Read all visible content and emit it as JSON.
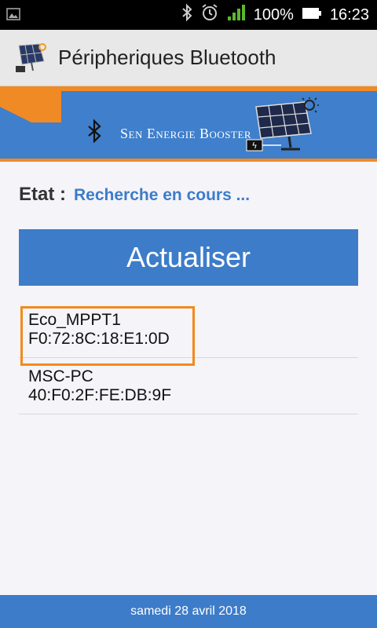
{
  "status_bar": {
    "battery": "100%",
    "time": "16:23",
    "icons": [
      "image-icon",
      "bluetooth-icon",
      "alarm-icon",
      "signal-icon",
      "battery-icon"
    ]
  },
  "action_bar": {
    "title": "Péripheriques Bluetooth",
    "icon": "solar-panel-icon"
  },
  "banner": {
    "brand": "Sen Energie Booster",
    "icons": [
      "bluetooth-icon",
      "solar-panel-icon"
    ]
  },
  "state": {
    "label": "Etat :",
    "value": "Recherche en cours ..."
  },
  "refresh_button": {
    "label": "Actualiser"
  },
  "devices": [
    {
      "name": "Eco_MPPT1",
      "address": "F0:72:8C:18:E1:0D",
      "highlighted": true
    },
    {
      "name": "MSC-PC",
      "address": "40:F0:2F:FE:DB:9F",
      "highlighted": false
    }
  ],
  "footer": {
    "date": "samedi 28 avril 2018"
  },
  "colors": {
    "primary": "#3d7cc9",
    "accent": "#f08a24",
    "highlight": "#f28a1c",
    "background": "#f5f4f9"
  }
}
